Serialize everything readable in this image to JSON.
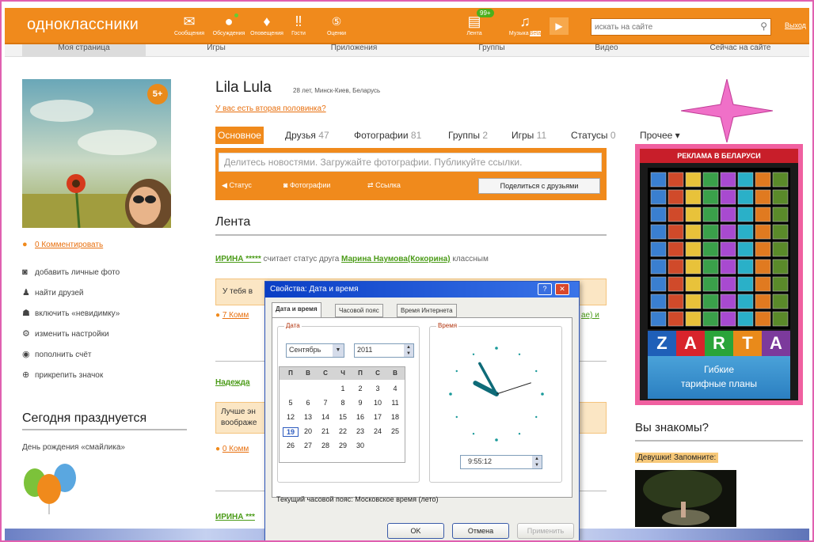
{
  "topbar": {
    "logo": "одноклассники",
    "icons": [
      {
        "label": "Сообщения",
        "icon": "envelope-icon",
        "glyph": "✉"
      },
      {
        "label": "Обсуждения",
        "icon": "speech-bubble-icon",
        "glyph": "💬"
      },
      {
        "label": "Оповещения",
        "icon": "bell-icon",
        "glyph": "🔔"
      },
      {
        "label": "Гости",
        "icon": "footprints-icon",
        "glyph": "👣"
      },
      {
        "label": "Оценки",
        "icon": "rating-icon",
        "glyph": "5"
      },
      {
        "label": "Лента",
        "icon": "feed-icon",
        "glyph": "▤",
        "badge": "99+"
      },
      {
        "label": "Музыка",
        "icon": "music-note-icon",
        "glyph": "♫",
        "badge_label": "Beta"
      }
    ],
    "search_placeholder": "искать на сайте",
    "exit_label": "Выход"
  },
  "nav": {
    "tabs": [
      "Моя страница",
      "Игры",
      "Приложения",
      "Группы",
      "Видео",
      "Сейчас на сайте"
    ]
  },
  "profile": {
    "name": "Lila Lula",
    "meta": "28 лет, Минск-Киев, Беларусь",
    "question": "У вас есть вторая половинка?",
    "avatar_badge": "5+",
    "comment_link": "0 Комментировать",
    "actions": [
      {
        "label": "добавить личные фото",
        "icon": "camera-icon",
        "glyph": "◙"
      },
      {
        "label": "найти друзей",
        "icon": "person-icon",
        "glyph": "♟"
      },
      {
        "label": "включить «невидимку»",
        "icon": "invisible-icon",
        "glyph": "☗"
      },
      {
        "label": "изменить настройки",
        "icon": "gear-icon",
        "glyph": "⚙"
      },
      {
        "label": "пополнить счёт",
        "icon": "coin-icon",
        "glyph": "◉"
      },
      {
        "label": "прикрепить значок",
        "icon": "plus-circle-icon",
        "glyph": "⊕"
      }
    ]
  },
  "tabs": [
    {
      "label": "Основное",
      "count": ""
    },
    {
      "label": "Друзья",
      "count": "47"
    },
    {
      "label": "Фотографии",
      "count": "81"
    },
    {
      "label": "Группы",
      "count": "2"
    },
    {
      "label": "Игры",
      "count": "11"
    },
    {
      "label": "Статусы",
      "count": "0"
    },
    {
      "label": "Прочее ▾",
      "count": ""
    }
  ],
  "composer": {
    "placeholder": "Делитесь новостями. Загружайте фотографии. Публикуйте ссылки.",
    "status": "Статус",
    "photos": "Фотографии",
    "link": "Ссылка",
    "share": "Поделиться с друзьями"
  },
  "feed": {
    "title": "Лента",
    "item1_user": "ИРИНА *****",
    "item1_text": "считает статус друга",
    "item1_friend": "Марина Наумова(Кокорина)",
    "item1_tail": "классным",
    "item1_quote": "У тебя в",
    "item1_comments": "7 Комм",
    "item1_right": "ae) и",
    "item2_user": "Надежда",
    "item2_quote1": "Лучше эн",
    "item2_quote2": "воображе",
    "item2_comments": "0 Комм",
    "item3_user": "ИРИНА ***"
  },
  "today": {
    "title": "Сегодня празднуется",
    "holiday": "День рождения «смайлика»"
  },
  "ad": {
    "header": "РЕКЛАМА В БЕЛАРУСИ",
    "letters": [
      "Z",
      "A",
      "R",
      "T",
      "A"
    ],
    "letter_colors": [
      "#1f5fb8",
      "#d8242c",
      "#2aa43a",
      "#e98a1a",
      "#7c3a9c"
    ],
    "line1": "Гибкие",
    "line2": "тарифные планы"
  },
  "sidebar": {
    "known": "Вы знакомы?",
    "remember": "Девушки! Запомните:"
  },
  "dialog": {
    "title": "Свойства: Дата и время",
    "help": "?",
    "close": "✕",
    "tabs": [
      "Дата и время",
      "Часовой пояс",
      "Время Интернета"
    ],
    "date_label": "Дата",
    "time_label": "Время",
    "month": "Сентябрь",
    "year": "2011",
    "weekdays": [
      "П",
      "В",
      "С",
      "Ч",
      "П",
      "С",
      "В"
    ],
    "days": [
      "1",
      "2",
      "3",
      "4",
      "5",
      "6",
      "7",
      "8",
      "9",
      "10",
      "11",
      "12",
      "13",
      "14",
      "15",
      "16",
      "17",
      "18",
      "19",
      "20",
      "21",
      "22",
      "23",
      "24",
      "25",
      "26",
      "27",
      "28",
      "29",
      "30"
    ],
    "first_weekday_index": 3,
    "today": "19",
    "time": "9:55:12",
    "clock_hours": 9,
    "clock_minutes": 55,
    "clock_seconds": 12,
    "tz_text": "Текущий часовой пояс: Московское время (лето)",
    "ok": "OK",
    "cancel": "Отмена",
    "apply": "Применить"
  }
}
